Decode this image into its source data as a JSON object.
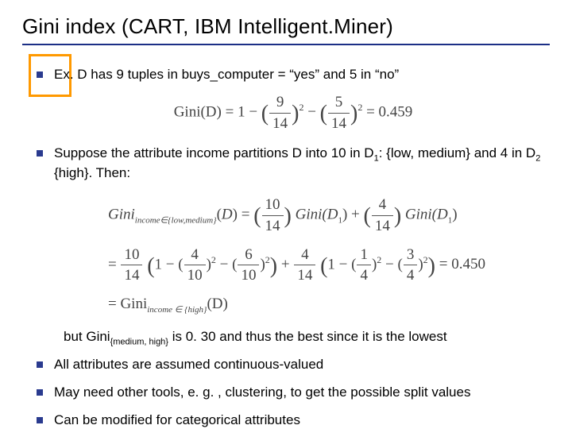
{
  "title": "Gini index (CART, IBM Intelligent.Miner)",
  "bullets": {
    "b1": "Ex.  D has 9 tuples in buys_computer = “yes” and 5 in “no”",
    "b2_a": "Suppose the attribute income partitions D into 10 in D",
    "b2_b": ": {low, medium} and 4 in D",
    "b2_c": " {high}. Then:",
    "b3_a": "but Gini",
    "b3_b": " is 0. 30 and thus the best since it is the lowest",
    "b4": "All attributes are assumed continuous-valued",
    "b5": "May need other tools, e. g. , clustering, to get the possible split values",
    "b6": "Can be modified for categorical attributes"
  },
  "subs": {
    "one": "1",
    "two": "2",
    "mh": "{medium, high}"
  },
  "formulas": {
    "gini_d": {
      "lhs": "Gini(D) = 1 − ",
      "term1_num": "9",
      "term1_den": "14",
      "term2_num": "5",
      "term2_den": "14",
      "sq": "2",
      "rhs": " = 0.459"
    },
    "split": {
      "lhs_sub": "income∈{low,medium}",
      "w1_num": "10",
      "w1_den": "14",
      "w2_num": "4",
      "w2_den": "14",
      "gini_arg1": "Gini(D",
      "gini_arg1_sub": "1",
      "gini_arg1_close": ")",
      "gini_arg2": "Gini(D",
      "gini_arg2_sub": "1",
      "gini_arg2_close": ")"
    },
    "expand": {
      "w1_num": "10",
      "w1_den": "14",
      "a_num": "4",
      "a_den": "10",
      "b_num": "6",
      "b_den": "10",
      "w2_num": "4",
      "w2_den": "14",
      "c_num": "1",
      "d_num": "3",
      "sq": "2"
    },
    "result": {
      "val": "= 0.450",
      "eq_sub": "income ∈ {high}",
      "eq_lhs": "= Gini",
      "eq_rhs": "(D)"
    }
  }
}
